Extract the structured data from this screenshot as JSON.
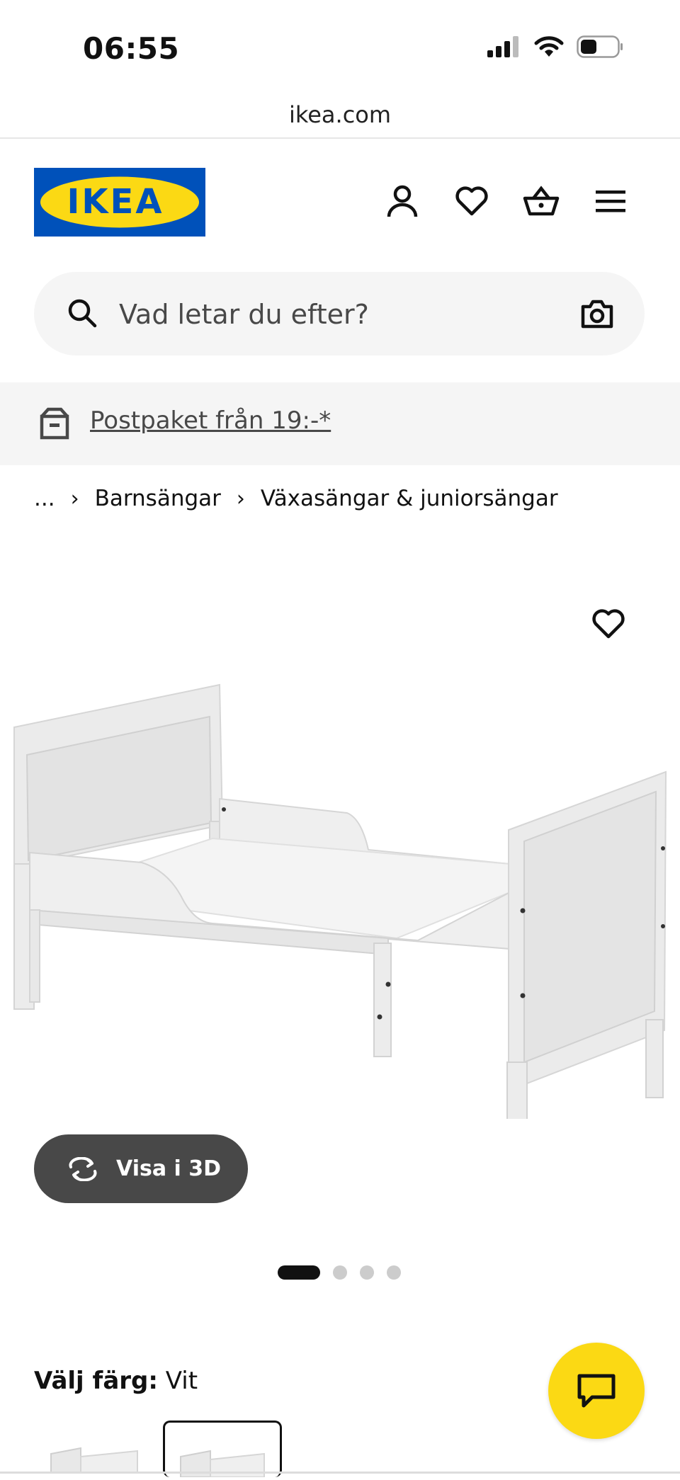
{
  "status_bar": {
    "time": "06:55"
  },
  "browser": {
    "url": "ikea.com"
  },
  "header": {
    "logo_text": "IKEA",
    "icons": [
      "profile-icon",
      "heart-icon",
      "cart-icon",
      "menu-icon"
    ]
  },
  "search": {
    "placeholder": "Vad letar du efter?"
  },
  "promo": {
    "text": "Postpaket från 19:-*"
  },
  "breadcrumb": {
    "ellipsis": "...",
    "items": [
      "Barnsängar",
      "Växasängar & juniorsängar"
    ]
  },
  "product": {
    "view_3d_label": "Visa i 3D",
    "image_count": 4,
    "active_image_index": 0
  },
  "color": {
    "label": "Välj färg:",
    "value": "Vit"
  },
  "colors": {
    "brand_blue": "#0051ba",
    "brand_yellow": "#fbd914",
    "button_dark": "#484848"
  }
}
